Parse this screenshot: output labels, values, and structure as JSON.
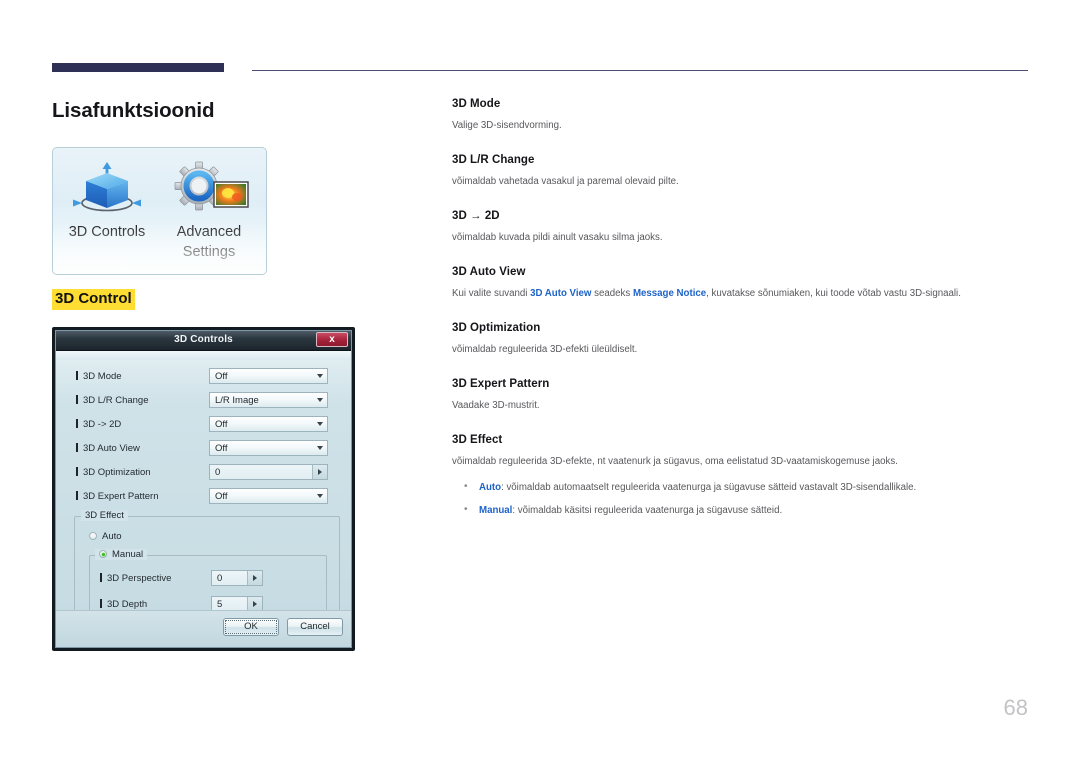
{
  "page": {
    "title": "Lisafunktsioonid",
    "number": "68",
    "header_accent_color": "#2e3055",
    "highlight_color": "#ffdd33",
    "link_color": "#1e63c8"
  },
  "menu_panel": {
    "tiles": [
      {
        "icon": "3d-cube-icon",
        "caption": "3D Controls"
      },
      {
        "icon": "gear-picture-icon",
        "caption": "Advanced Settings"
      }
    ]
  },
  "section_tag": "3D Control",
  "dialog": {
    "title": "3D Controls",
    "close_label": "x",
    "fields": [
      {
        "label": "3D Mode",
        "value": "Off",
        "control": "dropdown"
      },
      {
        "label": "3D L/R Change",
        "value": "L/R Image",
        "control": "dropdown"
      },
      {
        "label": "3D -> 2D",
        "value": "Off",
        "control": "dropdown"
      },
      {
        "label": "3D Auto View",
        "value": "Off",
        "control": "dropdown"
      },
      {
        "label": "3D Optimization",
        "value": "0",
        "control": "stepper"
      },
      {
        "label": "3D Expert Pattern",
        "value": "Off",
        "control": "dropdown"
      }
    ],
    "effect_group": {
      "title": "3D Effect",
      "radio_auto": "Auto",
      "radio_manual": "Manual",
      "selected": "Manual",
      "manual_fields": [
        {
          "label": "3D Perspective",
          "value": "0",
          "control": "stepper"
        },
        {
          "label": "3D Depth",
          "value": "5",
          "control": "stepper"
        }
      ]
    },
    "buttons": {
      "ok": "OK",
      "cancel": "Cancel"
    }
  },
  "content": {
    "mode": {
      "heading": "3D Mode",
      "body": "Valige 3D-sisendvorming."
    },
    "lr_change": {
      "heading": "3D L/R Change",
      "body": "võimaldab vahetada vasakul ja paremal olevaid pilte."
    },
    "to_2d": {
      "heading": "3D → 2D",
      "body": "võimaldab kuvada pildi ainult vasaku silma jaoks."
    },
    "auto_view": {
      "heading": "3D Auto View",
      "body_part1": "Kui valite suvandi ",
      "body_hl1": "3D Auto View",
      "body_part2": " seadeks ",
      "body_hl2": "Message Notice",
      "body_part3": ", kuvatakse sõnumiaken, kui toode võtab vastu 3D-signaali."
    },
    "optimization": {
      "heading": "3D Optimization",
      "body": "võimaldab reguleerida 3D-efekti üleüldiselt."
    },
    "expert_pattern": {
      "heading": "3D Expert Pattern",
      "body": "Vaadake 3D-mustrit."
    },
    "effect": {
      "heading": "3D Effect",
      "body": "võimaldab reguleerida 3D-efekte, nt vaatenurk ja sügavus, oma eelistatud 3D-vaatamiskogemuse jaoks.",
      "bullets": [
        {
          "hl": "Auto",
          "rest": ": võimaldab automaatselt reguleerida vaatenurga ja sügavuse sätteid vastavalt 3D-sisendallikale."
        },
        {
          "hl": "Manual",
          "rest": ": võimaldab käsitsi reguleerida vaatenurga ja sügavuse sätteid."
        }
      ]
    }
  }
}
